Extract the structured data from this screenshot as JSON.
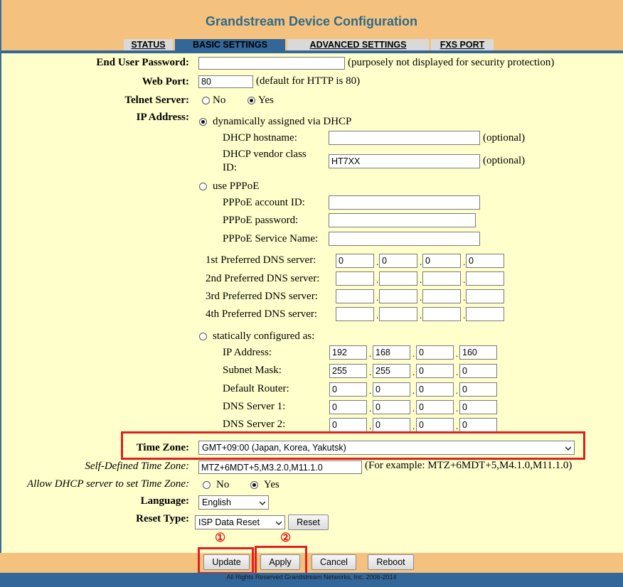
{
  "header": {
    "title": "Grandstream Device Configuration",
    "tabs": [
      {
        "label": "STATUS",
        "active": false
      },
      {
        "label": "BASIC SETTINGS",
        "active": true
      },
      {
        "label": "ADVANCED SETTINGS",
        "active": false
      },
      {
        "label": "FXS PORT",
        "active": false
      }
    ]
  },
  "form": {
    "end_user_password": {
      "label": "End User Password:",
      "value": "",
      "note": "(purposely not displayed for security protection)"
    },
    "web_port": {
      "label": "Web Port:",
      "value": "80",
      "note": "(default for HTTP is 80)"
    },
    "telnet": {
      "label": "Telnet Server:",
      "no": "No",
      "yes": "Yes",
      "selected": "Yes"
    },
    "ip_address": {
      "label": "IP Address:",
      "dhcp": {
        "option": "dynamically assigned via DHCP",
        "hostname_label": "DHCP hostname:",
        "hostname_value": "",
        "hostname_note": "(optional)",
        "vendor_label_1": "DHCP vendor class",
        "vendor_label_2": "ID:",
        "vendor_value": "HT7XX",
        "vendor_note": "(optional)"
      },
      "pppoe": {
        "option": "use PPPoE",
        "account_label": "PPPoE account ID:",
        "password_label": "PPPoE password:",
        "service_label": "PPPoE Service Name:"
      },
      "dns": [
        {
          "label": "1st Preferred DNS server:",
          "octets": [
            "0",
            "0",
            "0",
            "0"
          ]
        },
        {
          "label": "2nd Preferred DNS server:",
          "octets": [
            "",
            "",
            "",
            ""
          ]
        },
        {
          "label": "3rd Preferred DNS server:",
          "octets": [
            "",
            "",
            "",
            ""
          ]
        },
        {
          "label": "4th Preferred DNS server:",
          "octets": [
            "",
            "",
            "",
            ""
          ]
        }
      ],
      "static": {
        "option": "statically configured as:",
        "fields": [
          {
            "label": "IP Address:",
            "octets": [
              "192",
              "168",
              "0",
              "160"
            ]
          },
          {
            "label": "Subnet Mask:",
            "octets": [
              "255",
              "255",
              "0",
              "0"
            ]
          },
          {
            "label": "Default Router:",
            "octets": [
              "0",
              "0",
              "0",
              "0"
            ]
          },
          {
            "label": "DNS Server 1:",
            "octets": [
              "0",
              "0",
              "0",
              "0"
            ]
          },
          {
            "label": "DNS Server 2:",
            "octets": [
              "0",
              "0",
              "0",
              "0"
            ]
          }
        ]
      },
      "selected": "dhcp"
    },
    "time_zone": {
      "label": "Time Zone:",
      "value": "GMT+09:00 (Japan, Korea, Yakutsk)"
    },
    "self_defined_tz": {
      "label": "Self-Defined Time Zone:",
      "value": "MTZ+6MDT+5,M3.2.0,M11.1.0",
      "note": "(For example: MTZ+6MDT+5,M4.1.0,M11.1.0)"
    },
    "allow_dhcp_tz": {
      "label": "Allow DHCP server to set Time Zone:",
      "no": "No",
      "yes": "Yes",
      "selected": "Yes"
    },
    "language": {
      "label": "Language:",
      "value": "English"
    },
    "reset_type": {
      "label": "Reset Type:",
      "value": "ISP Data Reset",
      "reset_button": "Reset"
    }
  },
  "annotations": {
    "marker1": "①",
    "marker2": "②",
    "highlight_color": "#e02020"
  },
  "buttons": {
    "update": "Update",
    "apply": "Apply",
    "cancel": "Cancel",
    "reboot": "Reboot"
  },
  "footer": {
    "copyright": "All Rights Reserved Grandstream Networks, Inc. 2006-2014"
  },
  "colors": {
    "header_bg": "#F4C27E",
    "page_bg": "#FFFFCC",
    "accent": "#336699",
    "title": "#2e6a8a"
  }
}
